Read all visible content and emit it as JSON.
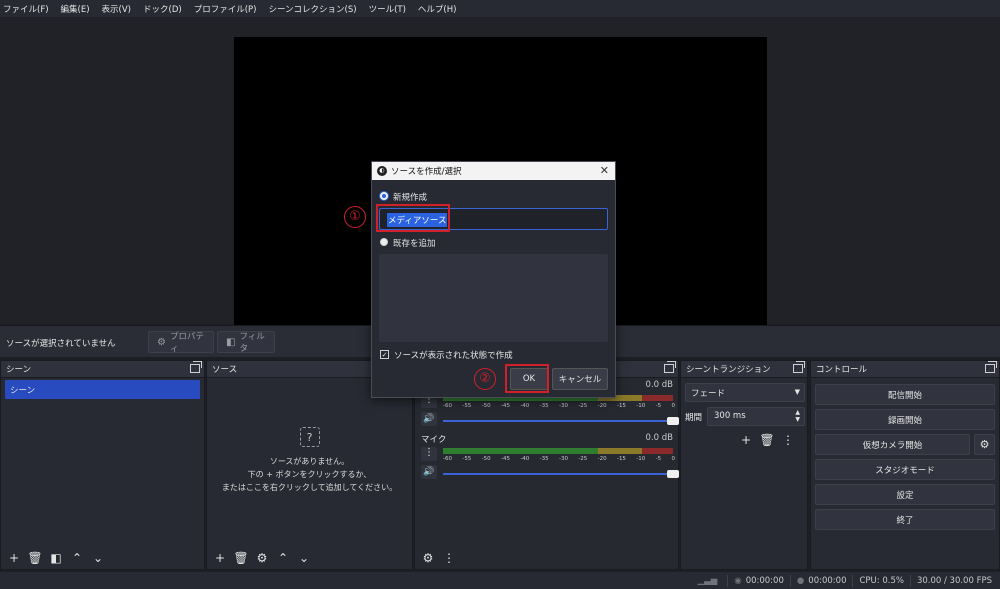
{
  "menu": [
    "ファイル(F)",
    "編集(E)",
    "表示(V)",
    "ドック(D)",
    "プロファイル(P)",
    "シーンコレクション(S)",
    "ツール(T)",
    "ヘルプ(H)"
  ],
  "source_toolbar": {
    "status": "ソースが選択されていません",
    "properties": "プロパティ",
    "filters": "フィルタ"
  },
  "scenes": {
    "title": "シーン",
    "items": [
      "シーン"
    ]
  },
  "sources": {
    "title": "ソース",
    "empty_line1": "ソースがありません。",
    "empty_line2": "下の + ボタンをクリックするか、",
    "empty_line3": "またはここを右クリックして追加してください。"
  },
  "mixer": {
    "ticks": [
      "-60",
      "-55",
      "-50",
      "-45",
      "-40",
      "-35",
      "-30",
      "-25",
      "-20",
      "-15",
      "-10",
      "-5",
      "0"
    ],
    "channels": [
      {
        "name": "",
        "db": "0.0 dB",
        "volume": 1.0
      },
      {
        "name": "マイク",
        "db": "0.0 dB",
        "volume": 1.0
      }
    ]
  },
  "transitions": {
    "title": "シーントランジション",
    "selected": "フェード",
    "duration_label": "期間",
    "duration": "300 ms"
  },
  "controls": {
    "title": "コントロール",
    "start_stream": "配信開始",
    "start_record": "録画開始",
    "virtual_cam": "仮想カメラ開始",
    "studio_mode": "スタジオモード",
    "settings": "設定",
    "exit": "終了"
  },
  "statusbar": {
    "stream_time": "00:00:00",
    "record_time": "00:00:00",
    "cpu": "CPU: 0.5%",
    "fps": "30.00 / 30.00 FPS"
  },
  "dialog": {
    "title": "ソースを作成/選択",
    "create_new": "新規作成",
    "name_value": "メディアソース",
    "add_existing": "既存を追加",
    "make_visible": "ソースが表示された状態で作成",
    "ok": "OK",
    "cancel": "キャンセル"
  },
  "annotations": {
    "step1": "①",
    "step2": "②",
    "color": "#d0202a"
  },
  "colors": {
    "accent": "#284bc0",
    "background": "#1e1f24",
    "panel": "#272a33"
  }
}
